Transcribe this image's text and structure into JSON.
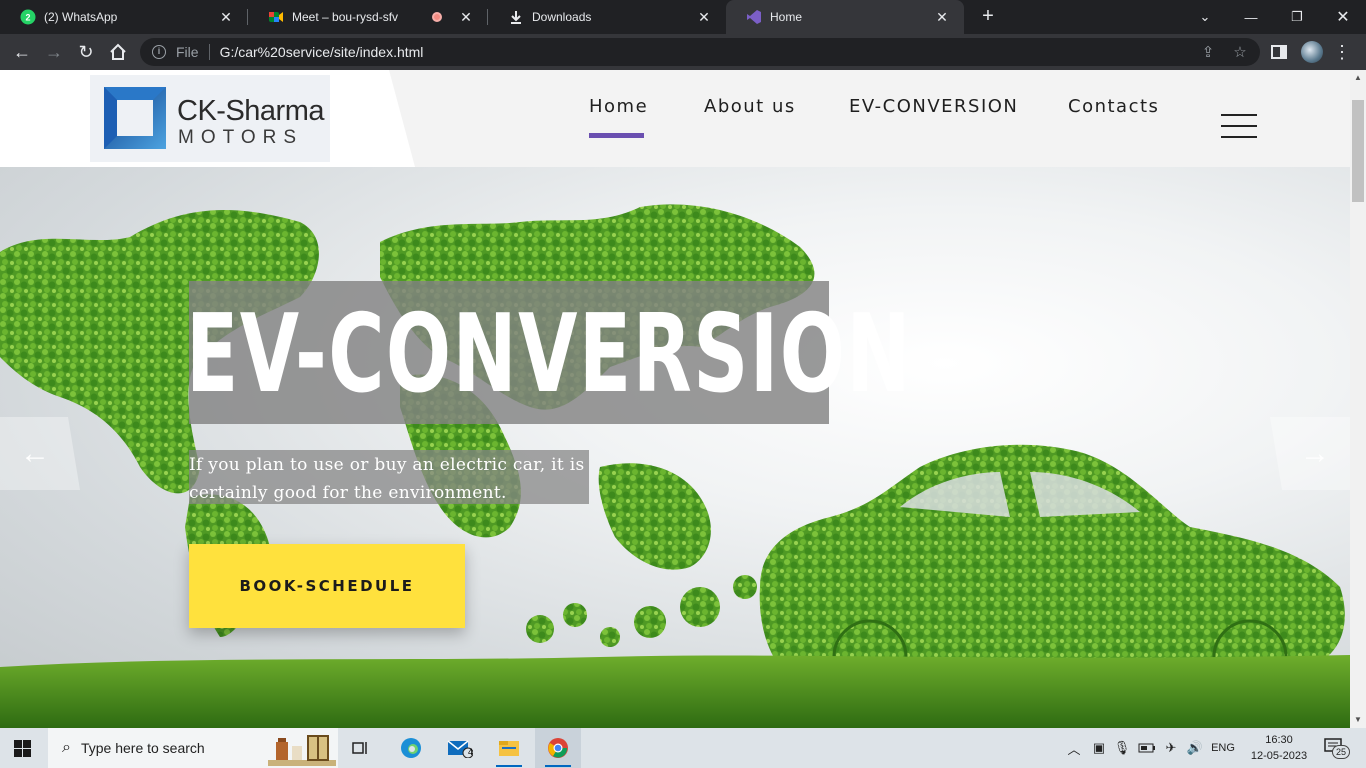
{
  "browser": {
    "tabs": [
      {
        "title": "(2) WhatsApp",
        "close": "✕"
      },
      {
        "title": "Meet – bou-rysd-sfv",
        "close": "✕"
      },
      {
        "title": "Downloads",
        "close": "✕"
      },
      {
        "title": "Home",
        "close": "✕"
      }
    ],
    "new_tab": "+",
    "address": {
      "scheme_label": "File",
      "url": "G:/car%20service/site/index.html"
    },
    "colors": {
      "chrome_dark": "#202124",
      "toolbar": "#35363a"
    }
  },
  "site": {
    "logo": {
      "line1": "CK-Sharma",
      "line2": "MOTORS"
    },
    "nav": [
      {
        "label": "Home",
        "active": true
      },
      {
        "label": "About us",
        "active": false
      },
      {
        "label": "EV-CONVERSION",
        "active": false
      },
      {
        "label": "Contacts",
        "active": false
      }
    ],
    "hero": {
      "title": "EV-CONVERSION",
      "subtitle": "If you plan to use or buy an electric car, it is certainly good for the environment.",
      "cta": "BOOK-SCHEDULE",
      "prev_arrow": "←",
      "next_arrow": "→"
    },
    "colors": {
      "accent_underline": "#6a4fb0",
      "cta_bg": "#ffe13d",
      "header_bg": "#f3f3f3"
    }
  },
  "taskbar": {
    "search_placeholder": "Type here to search",
    "mail_badge": "4",
    "tray": {
      "language": "ENG",
      "time": "16:30",
      "date": "12-05-2023",
      "notifications": "25"
    }
  }
}
